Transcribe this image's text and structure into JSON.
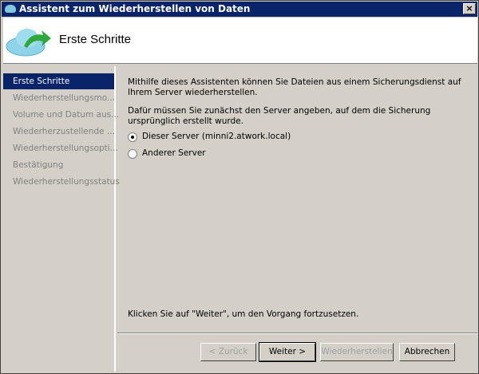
{
  "window": {
    "title": "Assistent zum Wiederherstellen von Daten",
    "close_label": "×"
  },
  "header": {
    "title": "Erste Schritte"
  },
  "sidebar": {
    "items": [
      {
        "label": "Erste Schritte",
        "active": true
      },
      {
        "label": "Wiederherstellungsmo..."
      },
      {
        "label": "Volume und Datum aus..."
      },
      {
        "label": "Wiederherzustellende ..."
      },
      {
        "label": "Wiederherstellungsopti..."
      },
      {
        "label": "Bestätigung"
      },
      {
        "label": "Wiederherstellungsstatus"
      }
    ]
  },
  "content": {
    "intro": "Mithilfe dieses Assistenten können Sie Dateien aus einem Sicherungsdienst auf Ihrem Server wiederherstellen.",
    "prompt": "Dafür müssen Sie zunächst den Server angeben, auf dem die Sicherung ursprünglich erstellt wurde.",
    "options": [
      {
        "label": "Dieser Server (minni2.atwork.local)",
        "selected": true
      },
      {
        "label": "Anderer Server",
        "selected": false
      }
    ],
    "footer": "Klicken Sie auf \"Weiter\", um den Vorgang fortzusetzen."
  },
  "buttons": {
    "back": "< Zurück",
    "next": "Weiter >",
    "restore": "Wiederherstellen",
    "cancel": "Abbrechen"
  }
}
